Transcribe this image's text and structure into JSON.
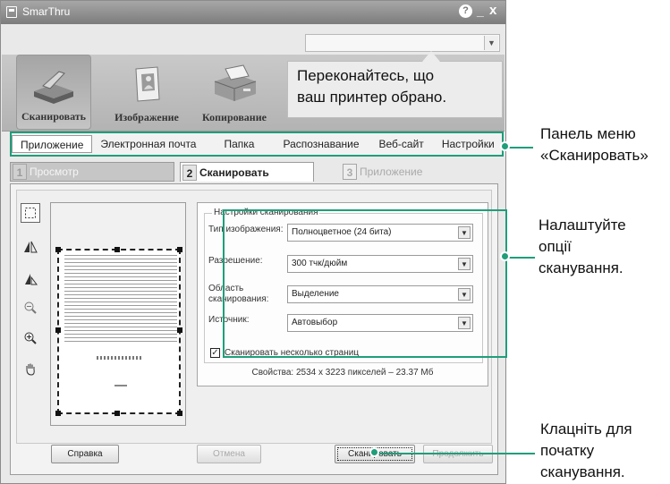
{
  "window": {
    "title": "SmarThru"
  },
  "titlebar_controls": {
    "help": "?",
    "minimize": "_",
    "close": "x"
  },
  "top_items": [
    {
      "label": "Сканировать",
      "icon": "scanner-icon",
      "active": true
    },
    {
      "label": "Изображение",
      "icon": "image-icon",
      "active": false
    },
    {
      "label": "Копирование",
      "icon": "copier-icon",
      "active": false
    }
  ],
  "tooltip": {
    "line1": "Переконайтесь, що",
    "line2": "ваш принтер обрано."
  },
  "menu": {
    "items": [
      "Приложение",
      "Электронная почта",
      "Папка",
      "Распознавание",
      "Веб-сайт",
      "Настройки"
    ],
    "active_index": 0
  },
  "steps": [
    {
      "num": "1",
      "label": "Просмотр"
    },
    {
      "num": "2",
      "label": "Сканировать"
    },
    {
      "num": "3",
      "label": "Приложение"
    }
  ],
  "tools": [
    "select-area-icon",
    "flip-horizontal-icon",
    "rotate-icon",
    "zoom-out-icon",
    "zoom-in-icon",
    "hand-pan-icon"
  ],
  "scan_settings": {
    "group_title": "Настройки сканирования",
    "image_type": {
      "label": "Тип изображения:",
      "value": "Полноцветное (24 бита)"
    },
    "resolution": {
      "label": "Разрешение:",
      "value": "300 тчк/дюйм"
    },
    "area": {
      "label_line1": "Область",
      "label_line2": "сканирования:",
      "value": "Выделение"
    },
    "source": {
      "label": "Источник:",
      "value": "Автовыбор"
    },
    "multi_page": {
      "label": "Сканировать несколько страниц",
      "checked": true,
      "mark": "✓"
    }
  },
  "properties": "Свойства: 2534 x 3223 пикселей – 23.37 Мб",
  "buttons": {
    "help": "Справка",
    "cancel": "Отмена",
    "scan": "Сканировать",
    "continue": "Продолжить"
  },
  "callouts": {
    "menu_panel": {
      "line1": "Панель меню",
      "line2": "«Сканировать»"
    },
    "options": {
      "line1": "Налаштуйте",
      "line2": "опції",
      "line3": "сканування."
    },
    "start": {
      "line1": "Клацніть для",
      "line2": "початку",
      "line3": "сканування."
    }
  },
  "colors": {
    "callout_accent": "#1f9e7a",
    "titlebar": "#8e8e8e",
    "window_bg": "#e9e9e9"
  }
}
